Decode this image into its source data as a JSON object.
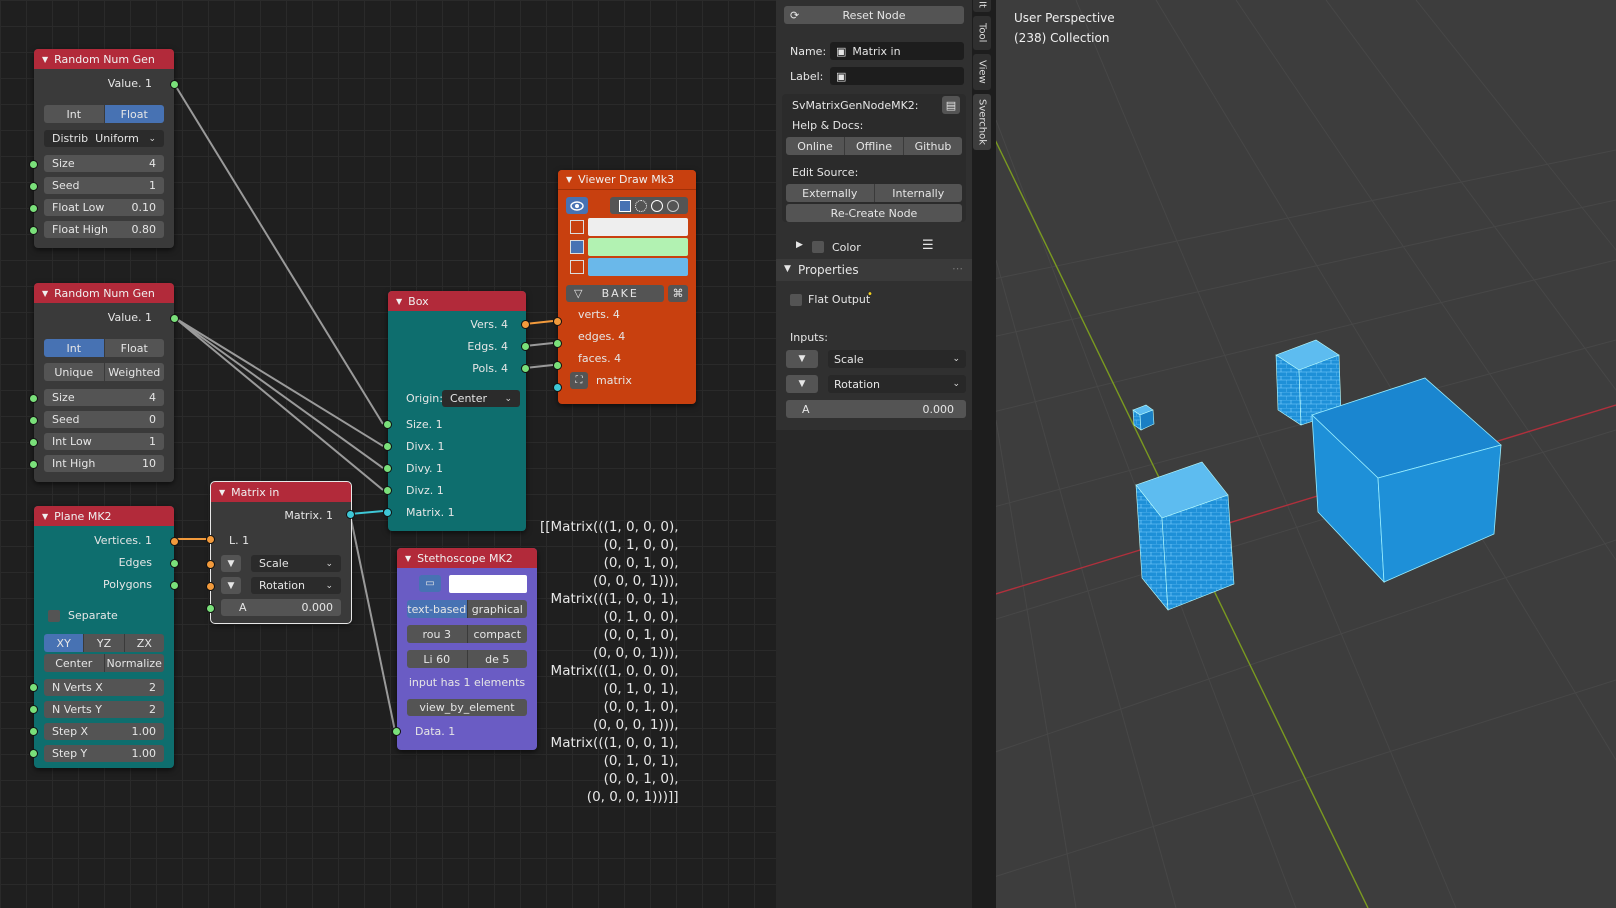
{
  "nodes": {
    "rng1": {
      "title": "Random Num Gen",
      "output": "Value. 1",
      "mode": [
        "Int",
        "Float"
      ],
      "mode_active": "Float",
      "distrib_label": "Distrib",
      "distrib_value": "Uniform",
      "fields": [
        {
          "label": "Size",
          "value": "4"
        },
        {
          "label": "Seed",
          "value": "1"
        },
        {
          "label": "Float Low",
          "value": "0.10"
        },
        {
          "label": "Float High",
          "value": "0.80"
        }
      ]
    },
    "rng2": {
      "title": "Random Num Gen",
      "output": "Value. 1",
      "mode": [
        "Int",
        "Float"
      ],
      "mode_active": "Int",
      "mode2": [
        "Unique",
        "Weighted"
      ],
      "fields": [
        {
          "label": "Size",
          "value": "4"
        },
        {
          "label": "Seed",
          "value": "0"
        },
        {
          "label": "Int Low",
          "value": "1"
        },
        {
          "label": "Int High",
          "value": "10"
        }
      ]
    },
    "plane": {
      "title": "Plane MK2",
      "outputs": [
        "Vertices. 1",
        "Edges",
        "Polygons"
      ],
      "separate": "Separate",
      "axes": [
        "XY",
        "YZ",
        "ZX"
      ],
      "axes_active": "XY",
      "pos": [
        "Center",
        "Normalize"
      ],
      "fields": [
        {
          "label": "N Verts X",
          "value": "2"
        },
        {
          "label": "N Verts Y",
          "value": "2"
        },
        {
          "label": "Step X",
          "value": "1.00"
        },
        {
          "label": "Step Y",
          "value": "1.00"
        }
      ]
    },
    "matrix": {
      "title": "Matrix in",
      "output": "Matrix. 1",
      "input": "L. 1",
      "scale": "Scale",
      "rotation": "Rotation",
      "a_label": "A",
      "a_value": "0.000"
    },
    "box": {
      "title": "Box",
      "outputs": [
        "Vers. 4",
        "Edgs. 4",
        "Pols. 4"
      ],
      "origin_label": "Origin:",
      "origin_value": "Center",
      "inputs": [
        "Size. 1",
        "Divx. 1",
        "Divy. 1",
        "Divz. 1",
        "Matrix. 1"
      ]
    },
    "viewer": {
      "title": "Viewer Draw Mk3",
      "bake": "BAKE",
      "inputs": [
        "verts. 4",
        "edges. 4",
        "faces. 4",
        "matrix"
      ],
      "colors": {
        "verts": "#eeeeee",
        "edges": "#b2f2b2",
        "faces": "#6ab8ea"
      }
    },
    "steth": {
      "title": "Stethoscope MK2",
      "mode": [
        "text-based",
        "graphical"
      ],
      "mode_active": "text-based",
      "opts1": [
        "rou  3",
        "compact"
      ],
      "opts2": [
        "Li  60",
        "de   5"
      ],
      "info": "input has 1 elements",
      "view_btn": "view_by_element",
      "input": "Data. 1"
    }
  },
  "stethoscope_output": "[[Matrix(((1, 0, 0, 0),\n(0, 1, 0, 0),\n(0, 0, 1, 0),\n(0, 0, 0, 1))),\nMatrix(((1, 0, 0, 1),\n(0, 1, 0, 0),\n(0, 0, 1, 0),\n(0, 0, 0, 1))),\nMatrix(((1, 0, 0, 0),\n(0, 1, 0, 1),\n(0, 0, 1, 0),\n(0, 0, 0, 1))),\nMatrix(((1, 0, 0, 1),\n(0, 1, 0, 1),\n(0, 0, 1, 0),\n(0, 0, 0, 1)))]]",
  "panel": {
    "reset_node": "Reset Node",
    "name_label": "Name:",
    "name_value": "Matrix in",
    "label_label": "Label:",
    "label_value": "",
    "node_class": "SvMatrixGenNodeMK2:",
    "help_docs": "Help & Docs:",
    "help_buttons": [
      "Online",
      "Offline",
      "Github"
    ],
    "edit_source": "Edit Source:",
    "edit_buttons": [
      "Externally",
      "Internally"
    ],
    "recreate": "Re-Create Node",
    "color": "Color",
    "properties": "Properties",
    "flat_output": "Flat Output",
    "inputs": "Inputs:",
    "input_selects": [
      "Scale",
      "Rotation"
    ],
    "a_label": "A",
    "a_value": "0.000"
  },
  "vertical_tabs": [
    "It",
    "Tool",
    "View",
    "Sverchok"
  ],
  "viewport": {
    "line1": "User Perspective",
    "line2": "(238) Collection",
    "cube_color": "#1e90d8"
  },
  "colors": {
    "node_header_red": "#b22a3a",
    "node_body_teal": "#0e6e6e",
    "viewer_body": "#c8400f",
    "steth_body": "#6a5cc4",
    "matrix_body": "#3a3a3a",
    "accent_blue": "#4772b3"
  }
}
